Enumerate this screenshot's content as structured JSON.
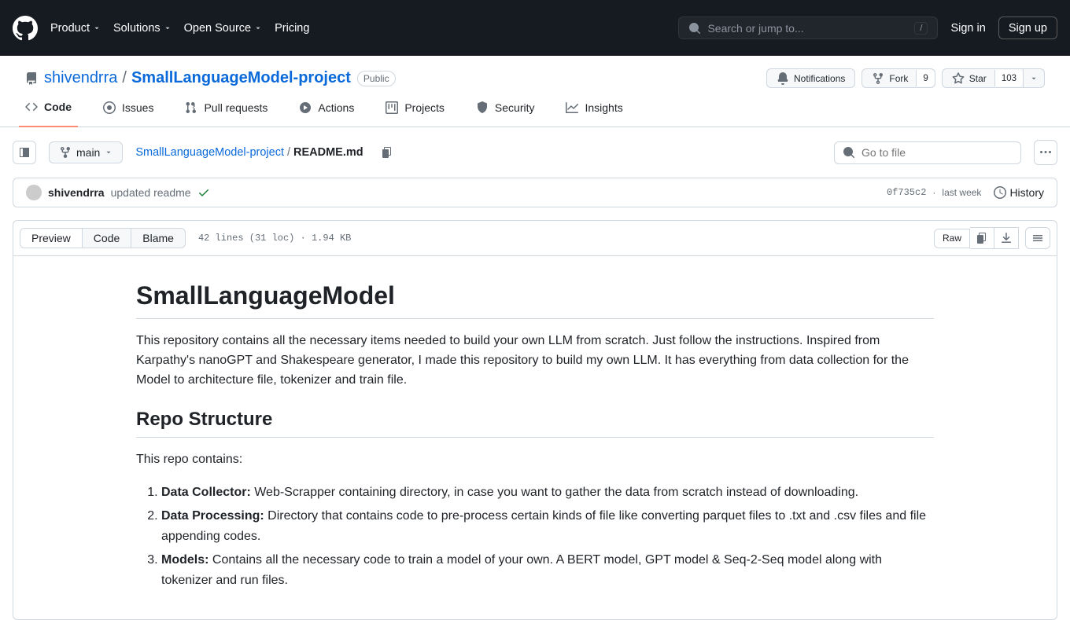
{
  "header": {
    "nav": [
      "Product",
      "Solutions",
      "Open Source",
      "Pricing"
    ],
    "search_placeholder": "Search or jump to...",
    "search_key": "/",
    "signin": "Sign in",
    "signup": "Sign up"
  },
  "repo": {
    "owner": "shivendrra",
    "name": "SmallLanguageModel-project",
    "visibility": "Public",
    "actions": {
      "notifications": "Notifications",
      "fork": "Fork",
      "fork_count": "9",
      "star": "Star",
      "star_count": "103"
    }
  },
  "tabs": [
    "Code",
    "Issues",
    "Pull requests",
    "Actions",
    "Projects",
    "Security",
    "Insights"
  ],
  "file_nav": {
    "branch": "main",
    "bc_repo": "SmallLanguageModel-project",
    "bc_file": "README.md",
    "file_search_placeholder": "Go to file"
  },
  "commit": {
    "author": "shivendrra",
    "message": "updated readme",
    "sha": "0f735c2",
    "sep": "·",
    "when": "last week",
    "history": "History"
  },
  "file_toolbar": {
    "tabs": [
      "Preview",
      "Code",
      "Blame"
    ],
    "stats": "42 lines (31 loc) · 1.94 KB",
    "raw": "Raw"
  },
  "readme": {
    "h1": "SmallLanguageModel",
    "intro": "This repository contains all the necessary items needed to build your own LLM from scratch. Just follow the instructions. Inspired from Karpathy's nanoGPT and Shakespeare generator, I made this repository to build my own LLM. It has everything from data collection for the Model to architecture file, tokenizer and train file.",
    "h2": "Repo Structure",
    "intro2": "This repo contains:",
    "items": [
      {
        "title": "Data Collector:",
        "body": " Web-Scrapper containing directory, in case you want to gather the data from scratch instead of downloading."
      },
      {
        "title": "Data Processing:",
        "body": " Directory that contains code to pre-process certain kinds of file like converting parquet files to .txt and .csv files and file appending codes."
      },
      {
        "title": "Models:",
        "body": " Contains all the necessary code to train a model of your own. A BERT model, GPT model & Seq-2-Seq model along with tokenizer and run files."
      }
    ]
  }
}
